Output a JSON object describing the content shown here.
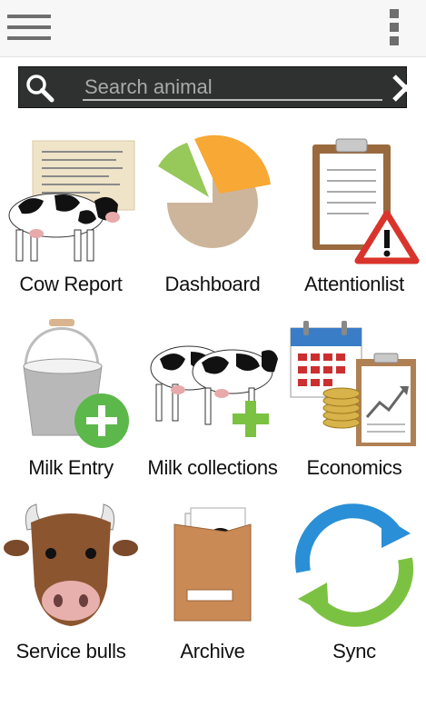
{
  "toolbar": {
    "menu_icon": "hamburger-menu-icon",
    "overflow_icon": "more-vertical-icon"
  },
  "search": {
    "placeholder": "Search animal",
    "value": ""
  },
  "tiles": [
    {
      "label": "Cow Report",
      "icon": "cow-report-icon"
    },
    {
      "label": "Dashboard",
      "icon": "pie-chart-icon"
    },
    {
      "label": "Attentionlist",
      "icon": "clipboard-warning-icon"
    },
    {
      "label": "Milk Entry",
      "icon": "milk-bucket-add-icon"
    },
    {
      "label": "Milk collections",
      "icon": "cows-add-icon"
    },
    {
      "label": "Economics",
      "icon": "calendar-coins-chart-icon"
    },
    {
      "label": "Service bulls",
      "icon": "bull-head-icon"
    },
    {
      "label": "Archive",
      "icon": "archive-box-icon"
    },
    {
      "label": "Sync",
      "icon": "sync-arrows-icon"
    }
  ],
  "colors": {
    "pie_green": "#97c85a",
    "pie_orange": "#f8a834",
    "pie_tan": "#ccb59b",
    "add_green": "#5cb84a",
    "warning_red": "#d9342b"
  }
}
